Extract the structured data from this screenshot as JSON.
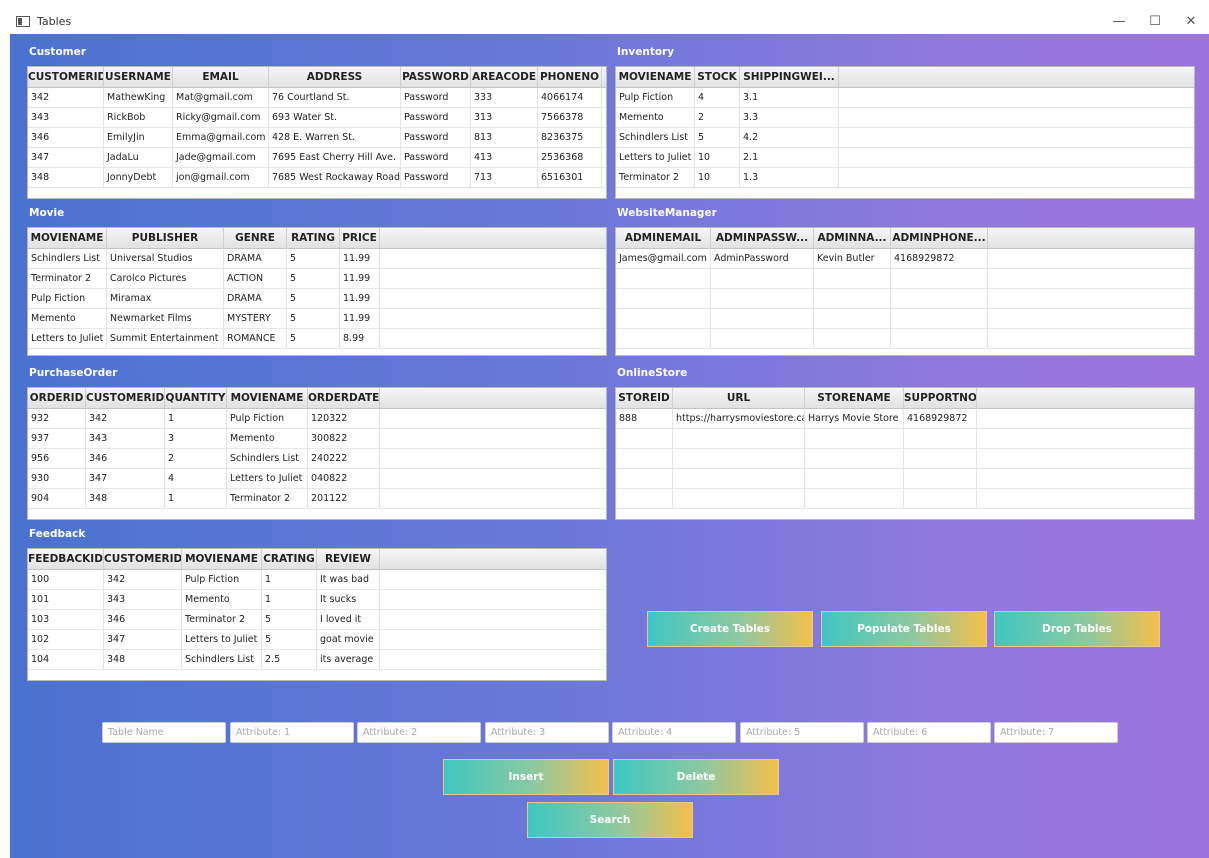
{
  "window": {
    "title": "Tables",
    "minimize_glyph": "—",
    "maximize_glyph": "☐",
    "close_glyph": "✕"
  },
  "customer": {
    "title": "Customer",
    "columns": [
      "CUSTOMERID",
      "USERNAME",
      "EMAIL",
      "ADDRESS",
      "PASSWORD",
      "AREACODE",
      "PHONENO"
    ],
    "rows": [
      [
        "342",
        "MathewKing",
        "Mat@gmail.com",
        "76 Courtland St.",
        "Password",
        "333",
        "4066174"
      ],
      [
        "343",
        "RickBob",
        "Ricky@gmail.com",
        "693 Water St.",
        "Password",
        "313",
        "7566378"
      ],
      [
        "346",
        "EmilyJin",
        "Emma@gmail.com",
        "428 E. Warren St.",
        "Password",
        "813",
        "8236375"
      ],
      [
        "347",
        "JadaLu",
        "Jade@gmail.com",
        "7695 East Cherry Hill Ave.",
        "Password",
        "413",
        "2536368"
      ],
      [
        "348",
        "JonnyDebt",
        "jon@gmail.com",
        "7685 West Rockaway Road",
        "Password",
        "713",
        "6516301"
      ]
    ]
  },
  "inventory": {
    "title": "Inventory",
    "columns": [
      "MOVIENAME",
      "STOCK",
      "SHIPPINGWEI..."
    ],
    "rows": [
      [
        "Pulp Fiction",
        "4",
        "3.1"
      ],
      [
        "Memento",
        "2",
        "3.3"
      ],
      [
        "Schindlers List",
        "5",
        "4.2"
      ],
      [
        "Letters to Juliet",
        "10",
        "2.1"
      ],
      [
        "Terminator 2",
        "10",
        "1.3"
      ]
    ]
  },
  "movie": {
    "title": "Movie",
    "columns": [
      "MOVIENAME",
      "PUBLISHER",
      "GENRE",
      "RATING",
      "PRICE"
    ],
    "rows": [
      [
        "Schindlers List",
        "Universal Studios",
        "DRAMA",
        "5",
        "11.99"
      ],
      [
        "Terminator 2",
        "Carolco Pictures",
        "ACTION",
        "5",
        "11.99"
      ],
      [
        "Pulp Fiction",
        "Miramax",
        "DRAMA",
        "5",
        "11.99"
      ],
      [
        "Memento",
        "Newmarket Films",
        "MYSTERY",
        "5",
        "11.99"
      ],
      [
        "Letters to Juliet",
        "Summit Entertainment",
        "ROMANCE",
        "5",
        "8.99"
      ]
    ]
  },
  "website_manager": {
    "title": "WebsiteManager",
    "columns": [
      "ADMINEMAIL",
      "ADMINPASSW...",
      "ADMINNA...",
      "ADMINPHONE..."
    ],
    "rows": [
      [
        "James@gmail.com",
        "AdminPassword",
        "Kevin Butler",
        "4168929872"
      ]
    ]
  },
  "purchase_order": {
    "title": "PurchaseOrder",
    "columns": [
      "ORDERID",
      "CUSTOMERID",
      "QUANTITY",
      "MOVIENAME",
      "ORDERDATE"
    ],
    "rows": [
      [
        "932",
        "342",
        "1",
        "Pulp Fiction",
        "120322"
      ],
      [
        "937",
        "343",
        "3",
        "Memento",
        "300822"
      ],
      [
        "956",
        "346",
        "2",
        "Schindlers List",
        "240222"
      ],
      [
        "930",
        "347",
        "4",
        "Letters to Juliet",
        "040822"
      ],
      [
        "904",
        "348",
        "1",
        "Terminator 2",
        "201122"
      ]
    ]
  },
  "online_store": {
    "title": "OnlineStore",
    "columns": [
      "STOREID",
      "URL",
      "STORENAME",
      "SUPPORTNO"
    ],
    "rows": [
      [
        "888",
        "https://harrysmoviestore.ca",
        "Harrys Movie Store",
        "4168929872"
      ]
    ]
  },
  "feedback": {
    "title": "Feedback",
    "columns": [
      "FEEDBACKID",
      "CUSTOMERID",
      "MOVIENAME",
      "CRATING",
      "REVIEW"
    ],
    "rows": [
      [
        "100",
        "342",
        "Pulp Fiction",
        "1",
        "It was bad"
      ],
      [
        "101",
        "343",
        "Memento",
        "1",
        "It sucks"
      ],
      [
        "103",
        "346",
        "Terminator 2",
        "5",
        "I loved it"
      ],
      [
        "102",
        "347",
        "Letters to Juliet",
        "5",
        "goat movie"
      ],
      [
        "104",
        "348",
        "Schindlers List",
        "2.5",
        "its average"
      ]
    ]
  },
  "actions": {
    "create_label": "Create Tables",
    "populate_label": "Populate Tables",
    "drop_label": "Drop Tables",
    "insert_label": "Insert",
    "delete_label": "Delete",
    "search_label": "Search"
  },
  "form": {
    "table_name_placeholder": "Table Name",
    "attr1_placeholder": "Attribute: 1",
    "attr2_placeholder": "Attribute: 2",
    "attr3_placeholder": "Attribute: 3",
    "attr4_placeholder": "Attribute: 4",
    "attr5_placeholder": "Attribute: 5",
    "attr6_placeholder": "Attribute: 6",
    "attr7_placeholder": "Attribute: 7"
  },
  "colors": {
    "background_left": "#4a72d0",
    "background_right": "#9d74dd",
    "button_start": "#3fc7c3",
    "button_end": "#f3c04a"
  }
}
